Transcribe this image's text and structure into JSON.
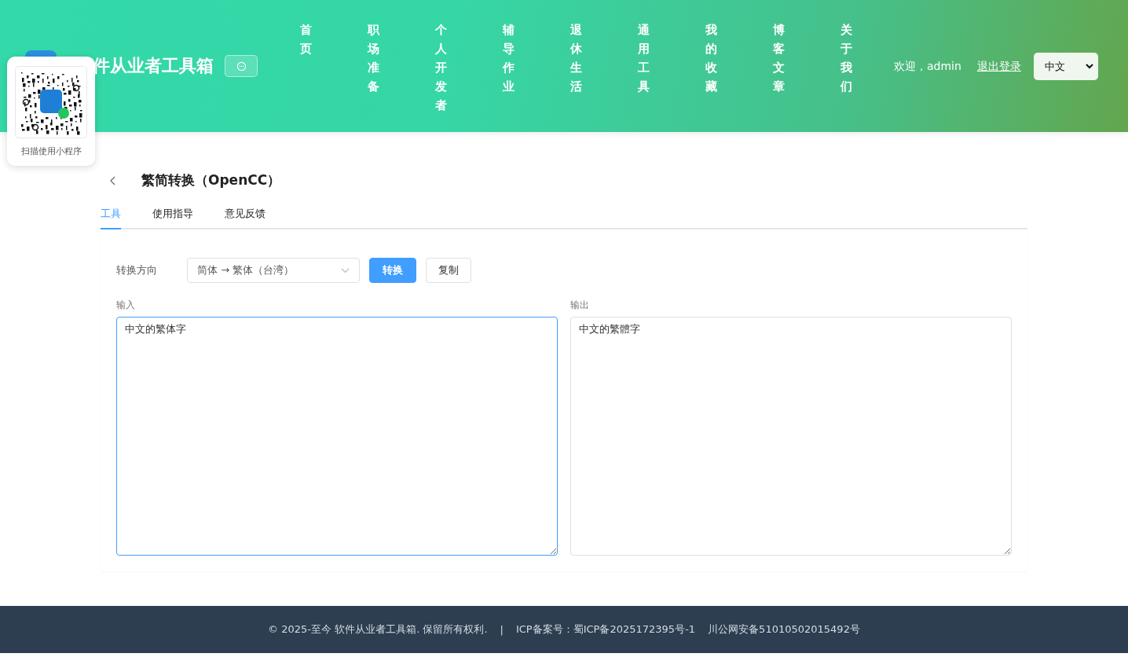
{
  "header": {
    "title": "件从业者工具箱",
    "nav": [
      {
        "label": "首页",
        "selected": false
      },
      {
        "label": "职场准备",
        "selected": false
      },
      {
        "label": "个人开发者",
        "selected": false
      },
      {
        "label": "辅导作业",
        "selected": false
      },
      {
        "label": "退休生活",
        "selected": false
      },
      {
        "label": "通用工具",
        "selected": false
      },
      {
        "label": "我的收藏",
        "selected": false
      },
      {
        "label": "博客文章",
        "selected": false
      },
      {
        "label": "关于我们",
        "selected": false
      }
    ],
    "welcome": "欢迎，admin",
    "logout": "退出登录",
    "language": "中文"
  },
  "qr_popup": {
    "caption": "扫描使用小程序"
  },
  "page": {
    "title": "繁简转换（OpenCC）",
    "tabs": [
      {
        "label": "工具",
        "selected": true
      },
      {
        "label": "使用指导",
        "selected": false
      },
      {
        "label": "意见反馈",
        "selected": false
      }
    ],
    "direction_label": "转换方向",
    "direction": "简体 → 繁体（台湾）",
    "convert_button": "转换",
    "copy_button": "复制",
    "input": {
      "label": "输入",
      "value": "中文的繁体字",
      "focused": true
    },
    "output": {
      "label": "输出",
      "value": "中文的繁體字",
      "focused": false
    }
  },
  "footer": {
    "text": "© 2025-至今 软件从业者工具箱. 保留所有权利.",
    "separator": "|",
    "icp": "ICP备案号：蜀ICP备2025172395号-1",
    "police": "川公网安备51010502015492号"
  }
}
